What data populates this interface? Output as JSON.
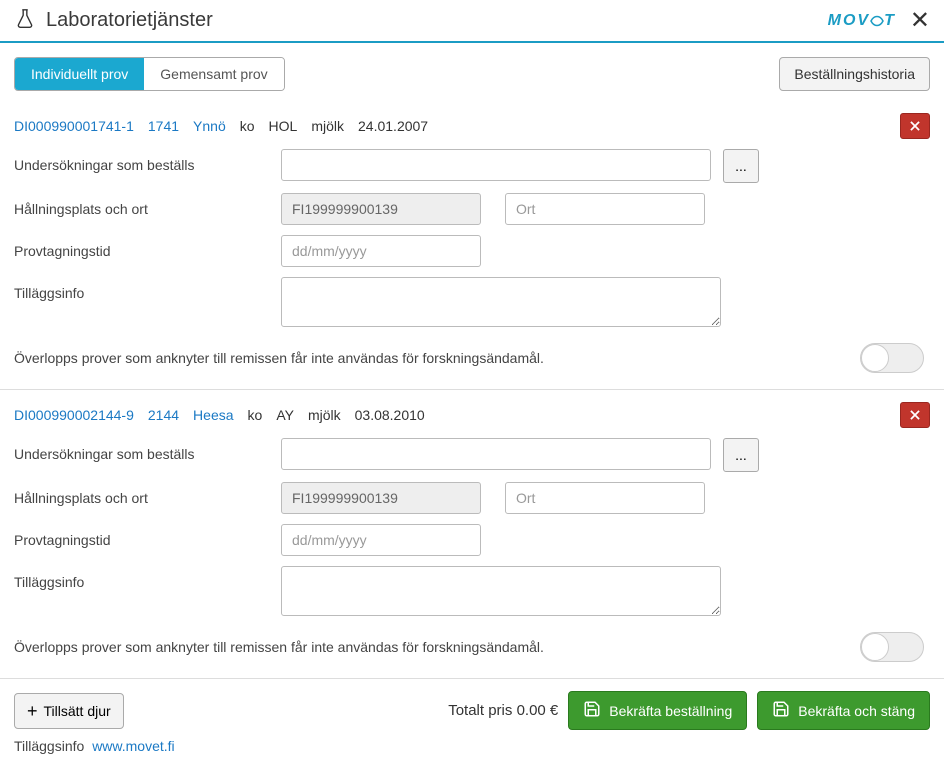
{
  "header": {
    "title": "Laboratorietjänster",
    "logo_text": "MOVET"
  },
  "toolbar": {
    "tab_individual": "Individuellt prov",
    "tab_shared": "Gemensamt prov",
    "history_btn": "Beställningshistoria"
  },
  "labels": {
    "examinations": "Undersökningar som beställs",
    "location": "Hållningsplats och ort",
    "sampling_time": "Provtagningstid",
    "extra_info": "Tilläggsinfo",
    "consent_text": "Överlopps prover som anknyter till remissen får inte användas för forskningsändamål.",
    "dots": "...",
    "ort_placeholder": "Ort",
    "date_placeholder": "dd/mm/yyyy"
  },
  "samples": [
    {
      "id": "DI000990001741-1",
      "short_id": "1741",
      "name": "Ynnö",
      "species": "ko",
      "breed": "HOL",
      "type": "mjölk",
      "date": "24.01.2007",
      "location_code": "FI199999900139"
    },
    {
      "id": "DI000990002144-9",
      "short_id": "2144",
      "name": "Heesa",
      "species": "ko",
      "breed": "AY",
      "type": "mjölk",
      "date": "03.08.2010",
      "location_code": "FI199999900139"
    }
  ],
  "footer": {
    "add_animal": "Tillsätt djur",
    "total_label": "Totalt pris",
    "total_value": "0.00 €",
    "confirm_order": "Bekräfta beställning",
    "confirm_close": "Bekräfta och stäng",
    "extra_label": "Tilläggsinfo",
    "link_text": "www.movet.fi"
  }
}
